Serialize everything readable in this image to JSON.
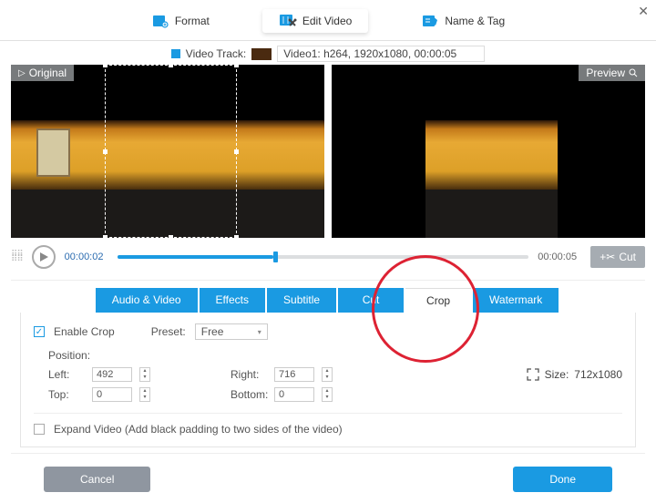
{
  "window": {
    "close_symbol": "✕"
  },
  "top_tabs": {
    "format": "Format",
    "edit_video": "Edit Video",
    "name_tag": "Name & Tag"
  },
  "video_track": {
    "label": "Video Track:",
    "selected": "Video1: h264, 1920x1080, 00:00:05"
  },
  "preview": {
    "original_badge": "Original",
    "preview_badge": "Preview"
  },
  "playback": {
    "current_time": "00:00:02",
    "total_time": "00:00:05",
    "cut_label": "Cut"
  },
  "edit_tabs": {
    "audio_video": "Audio & Video",
    "effects": "Effects",
    "subtitle": "Subtitle",
    "cut": "Cut",
    "crop": "Crop",
    "watermark": "Watermark"
  },
  "crop_panel": {
    "enable_label": "Enable Crop",
    "preset_label": "Preset:",
    "preset_value": "Free",
    "position_label": "Position:",
    "left_label": "Left:",
    "left_value": "492",
    "right_label": "Right:",
    "right_value": "716",
    "top_label": "Top:",
    "top_value": "0",
    "bottom_label": "Bottom:",
    "bottom_value": "0",
    "size_label": "Size:",
    "size_value": "712x1080",
    "expand_label": "Expand Video (Add black padding to two sides of the video)"
  },
  "footer": {
    "cancel": "Cancel",
    "done": "Done"
  }
}
